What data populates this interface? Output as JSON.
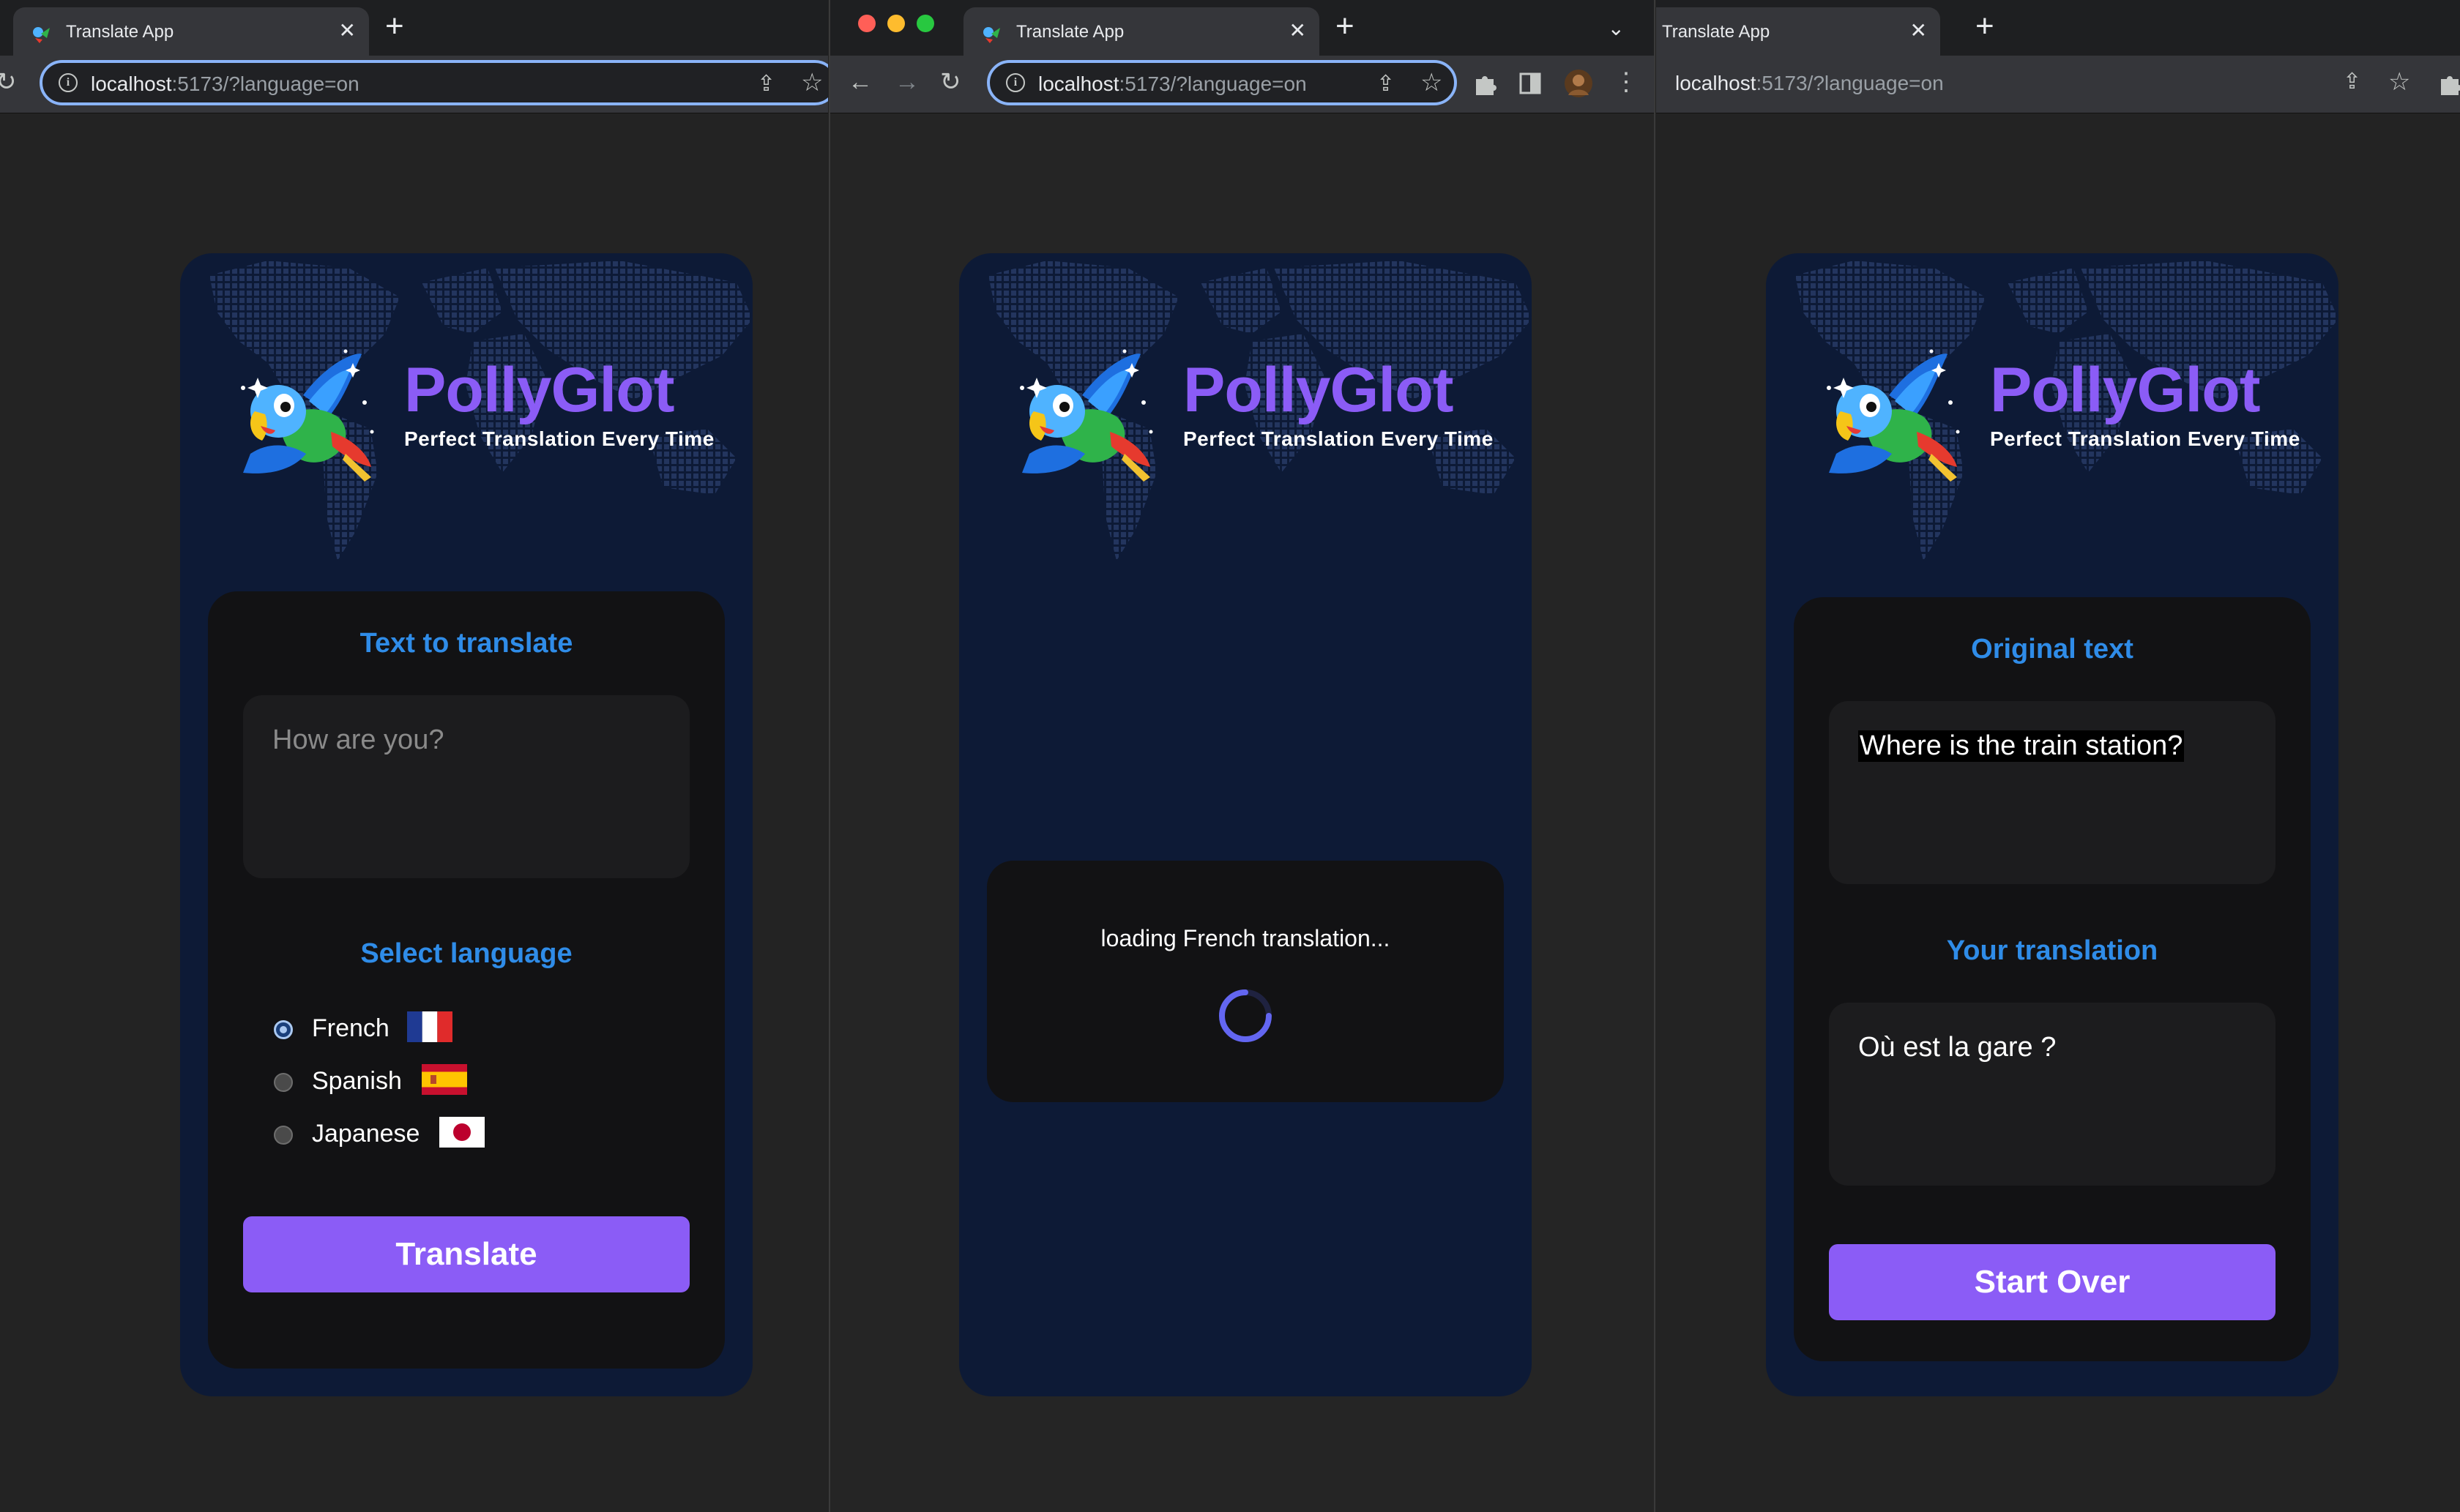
{
  "browser": {
    "tab_title": "Translate App",
    "url_host": "localhost",
    "url_rest": ":5173/?language=on"
  },
  "app": {
    "brand": "PollyGlot",
    "tagline": "Perfect Translation Every Time"
  },
  "screen_input": {
    "text_heading": "Text to translate",
    "text_placeholder": "How are you?",
    "language_heading": "Select language",
    "languages": [
      {
        "label": "French",
        "checked": true,
        "flag": "france-flag-icon"
      },
      {
        "label": "Spanish",
        "checked": false,
        "flag": "spain-flag-icon"
      },
      {
        "label": "Japanese",
        "checked": false,
        "flag": "japan-flag-icon"
      }
    ],
    "button_label": "Translate"
  },
  "screen_loading": {
    "message": "loading French translation..."
  },
  "screen_result": {
    "original_heading": "Original text",
    "original_value": "Where is the train station?",
    "translation_heading": "Your translation",
    "translation_value": "Où est la gare ?",
    "button_label": "Start Over"
  },
  "colors": {
    "accent": "#8b5cf6",
    "heading_blue": "#2f8ce8",
    "card_bg": "#0d1a36",
    "panel_bg": "#121214"
  }
}
